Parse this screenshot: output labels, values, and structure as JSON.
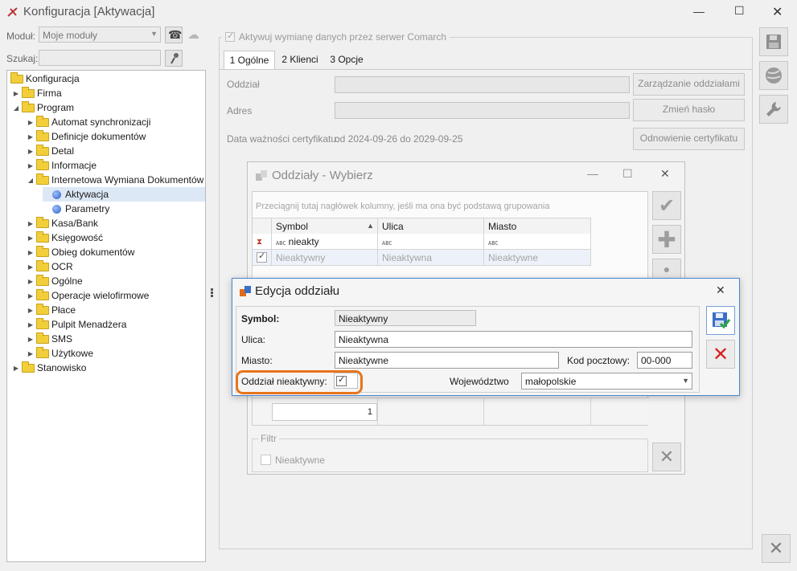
{
  "window": {
    "title": "Konfiguracja [Aktywacja]",
    "minimize": "—",
    "maximize": "☐",
    "close": "✕"
  },
  "left": {
    "module_label": "Moduł:",
    "module_value": "Moje moduły",
    "search_label": "Szukaj:",
    "search_value": ""
  },
  "tree": {
    "root": "Konfiguracja",
    "items": [
      {
        "label": "Firma"
      },
      {
        "label": "Program"
      },
      {
        "label": "Automat synchronizacji"
      },
      {
        "label": "Definicje dokumentów"
      },
      {
        "label": "Detal"
      },
      {
        "label": "Informacje"
      },
      {
        "label": "Internetowa Wymiana Dokumentów"
      },
      {
        "label": "Aktywacja"
      },
      {
        "label": "Parametry"
      },
      {
        "label": "Kasa/Bank"
      },
      {
        "label": "Księgowość"
      },
      {
        "label": "Obieg dokumentów"
      },
      {
        "label": "OCR"
      },
      {
        "label": "Ogólne"
      },
      {
        "label": "Operacje wielofirmowe"
      },
      {
        "label": "Płace"
      },
      {
        "label": "Pulpit Menadżera"
      },
      {
        "label": "SMS"
      },
      {
        "label": "Użytkowe"
      },
      {
        "label": "Stanowisko"
      }
    ]
  },
  "main": {
    "activate_checkbox_label": "Aktywuj wymianę danych przez serwer Comarch",
    "tabs": [
      {
        "label": "1 Ogólne"
      },
      {
        "label": "2 Klienci"
      },
      {
        "label": "3 Opcje"
      }
    ],
    "branch_label": "Oddział",
    "address_label": "Adres",
    "cert_label": "Data ważności certyfikatu:",
    "cert_value": "od 2024-09-26 do 2029-09-25",
    "btn_branches": "Zarządzanie oddziałami",
    "btn_password": "Zmień hasło",
    "btn_cert": "Odnowienie certyfikatu"
  },
  "dialog1": {
    "title": "Oddziały - Wybierz",
    "group_hint": "Przeciągnij tutaj nagłówek kolumny, jeśli ma ona być podstawą grupowania",
    "columns": [
      "Symbol",
      "Ulica",
      "Miasto"
    ],
    "filter_row": [
      "nieakty",
      "",
      ""
    ],
    "row1": [
      "Nieaktywny",
      "Nieaktywna",
      "Nieaktywne"
    ],
    "footer_count": "1",
    "filter_label": "Filtr",
    "filter_checkbox": "Nieaktywne"
  },
  "dialog2": {
    "title": "Edycja oddziału",
    "symbol_label": "Symbol:",
    "symbol_value": "Nieaktywny",
    "street_label": "Ulica:",
    "street_value": "Nieaktywna",
    "city_label": "Miasto:",
    "city_value": "Nieaktywne",
    "postal_label": "Kod pocztowy:",
    "postal_value": "00-000",
    "inactive_label": "Oddział nieaktywny:",
    "voivodeship_label": "Województwo",
    "voivodeship_value": "małopolskie"
  },
  "colors": {
    "highlight": "#e8741a",
    "accent_blue": "#2b5dc0",
    "cancel_red": "#d42020"
  }
}
